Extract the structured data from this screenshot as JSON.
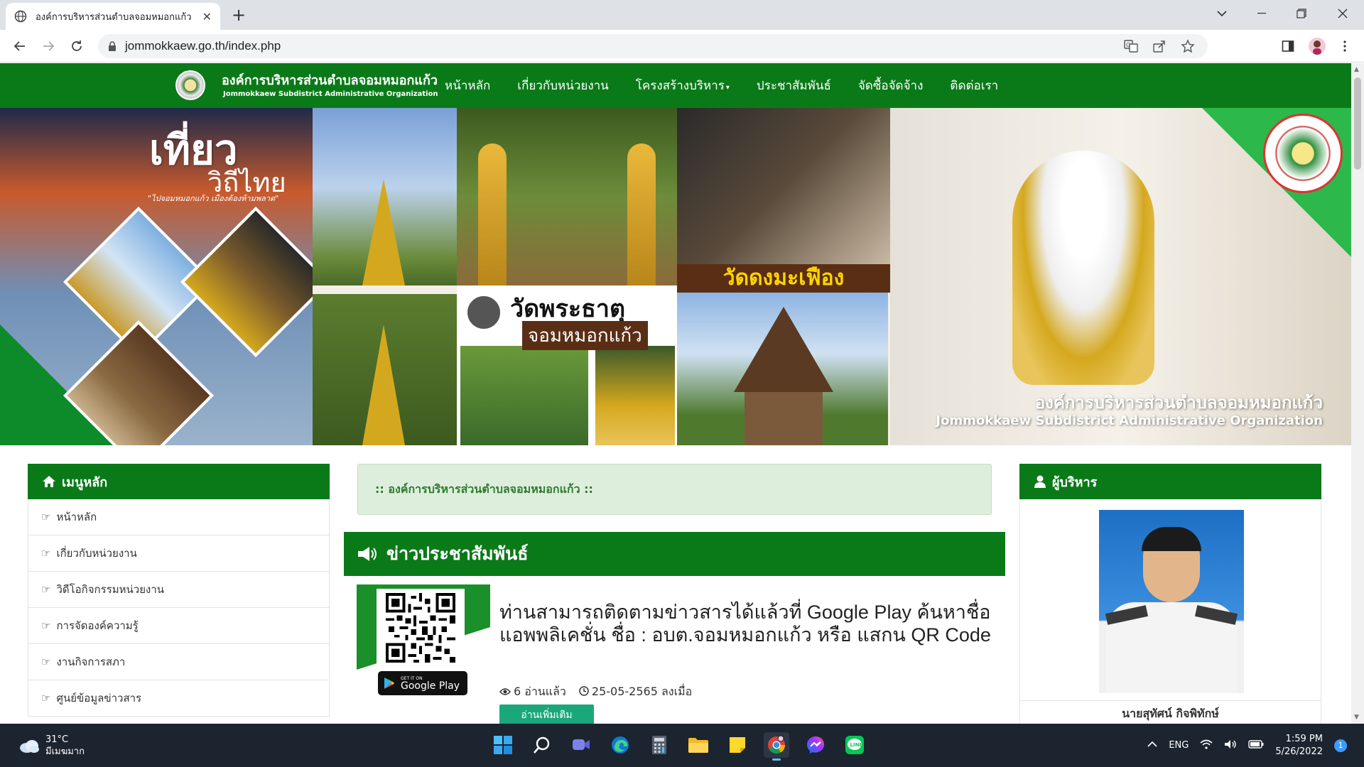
{
  "browser": {
    "tab_title": "องค์การบริหารส่วนตำบลจอมหมอกแก้ว",
    "url": "jommokkaew.go.th/index.php"
  },
  "site": {
    "name_th": "องค์การบริหารส่วนตำบลจอมหมอกแก้ว",
    "name_en": "Jommokkaew Subdistrict Administrative Organization",
    "menu": [
      {
        "label": "หน้าหลัก"
      },
      {
        "label": "เกี่ยวกับหน่วยงาน"
      },
      {
        "label": "โครงสร้างบริหาร"
      },
      {
        "label": "ประชาสัมพันธ์"
      },
      {
        "label": "จัดซื้อจัดจ้าง"
      },
      {
        "label": "ติดต่อเรา"
      }
    ]
  },
  "banner": {
    "title_1": "เที่ยว",
    "title_2": "วิถีไทย",
    "slogan": "\"ไปจอมหมอกแก้ว เมืองต้องห้ามพลาด\"",
    "wat_dong": "วัดดงมะเฟือง",
    "wat_phrathat_1": "วัดพระธาตุ",
    "wat_phrathat_2": "จอมหมอกแก้ว",
    "org_th": "องค์การบริหารส่วนตำบลจอมหมอกแก้ว",
    "org_en": "Jommokkaew Subdistrict Administrative Organization"
  },
  "sidebar": {
    "title": "เมนูหลัก",
    "items": [
      {
        "label": "หน้าหลัก"
      },
      {
        "label": "เกี่ยวกับหน่วยงาน"
      },
      {
        "label": "วิดีโอกิจกรรมหน่วยงาน"
      },
      {
        "label": "การจัดองค์ความรู้"
      },
      {
        "label": "งานกิจการสภา"
      },
      {
        "label": "ศูนย์ข้อมูลข่าวสาร"
      }
    ]
  },
  "welcome": ":: องค์การบริหารส่วนตำบลจอมหมอกแก้ว ::",
  "news": {
    "title": "ข่าวประชาสัมพันธ์",
    "item": {
      "headline": "ท่านสามารถติดตามข่าวสารได้แล้วที่ Google Play ค้นหาชื่อแอพพลิเคชั่น ชื่อ : อบต.จอมหมอกแก้ว หรือ แสกน QR Code",
      "views": "6 อ่านแล้ว",
      "date": "25-05-2565 ลงเมื่อ",
      "read_more": "อ่านเพิ่มเติม",
      "gp_small": "GET IT ON",
      "gp_big": "Google Play"
    }
  },
  "exec": {
    "title": "ผู้บริหาร",
    "name": "นายสุทัศน์ กิจพิทักษ์"
  },
  "taskbar": {
    "temp": "31°C",
    "weather": "มีเมฆมาก",
    "lang": "ENG",
    "time": "1:59 PM",
    "date": "5/26/2022",
    "notifications": "1"
  },
  "colors": {
    "site_green": "#0a7a19",
    "welcome_bg": "#ddeedd",
    "read_more": "#1aa87a"
  }
}
